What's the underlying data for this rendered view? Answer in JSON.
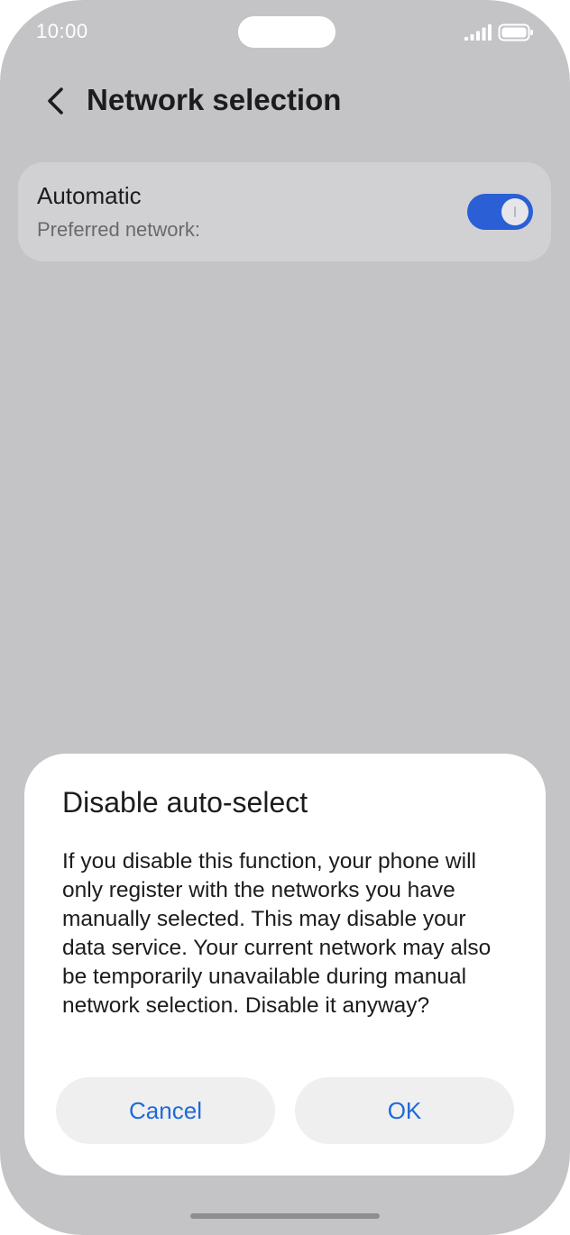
{
  "status_bar": {
    "time": "10:00"
  },
  "header": {
    "title": "Network selection",
    "back_icon": "chevron-left-icon"
  },
  "automatic": {
    "title": "Automatic",
    "subtitle": "Preferred network:",
    "toggle_on": true
  },
  "dialog": {
    "title": "Disable auto-select",
    "message": "If you disable this function, your phone will only register with the networks you have manually selected. This may disable your data service. Your current network may also be temporarily unavailable during manual network selection. Disable it anyway?",
    "cancel_label": "Cancel",
    "ok_label": "OK"
  },
  "colors": {
    "accent": "#2a5fd6",
    "button_text": "#1f6ad8",
    "backdrop": "#c4c4c6"
  }
}
